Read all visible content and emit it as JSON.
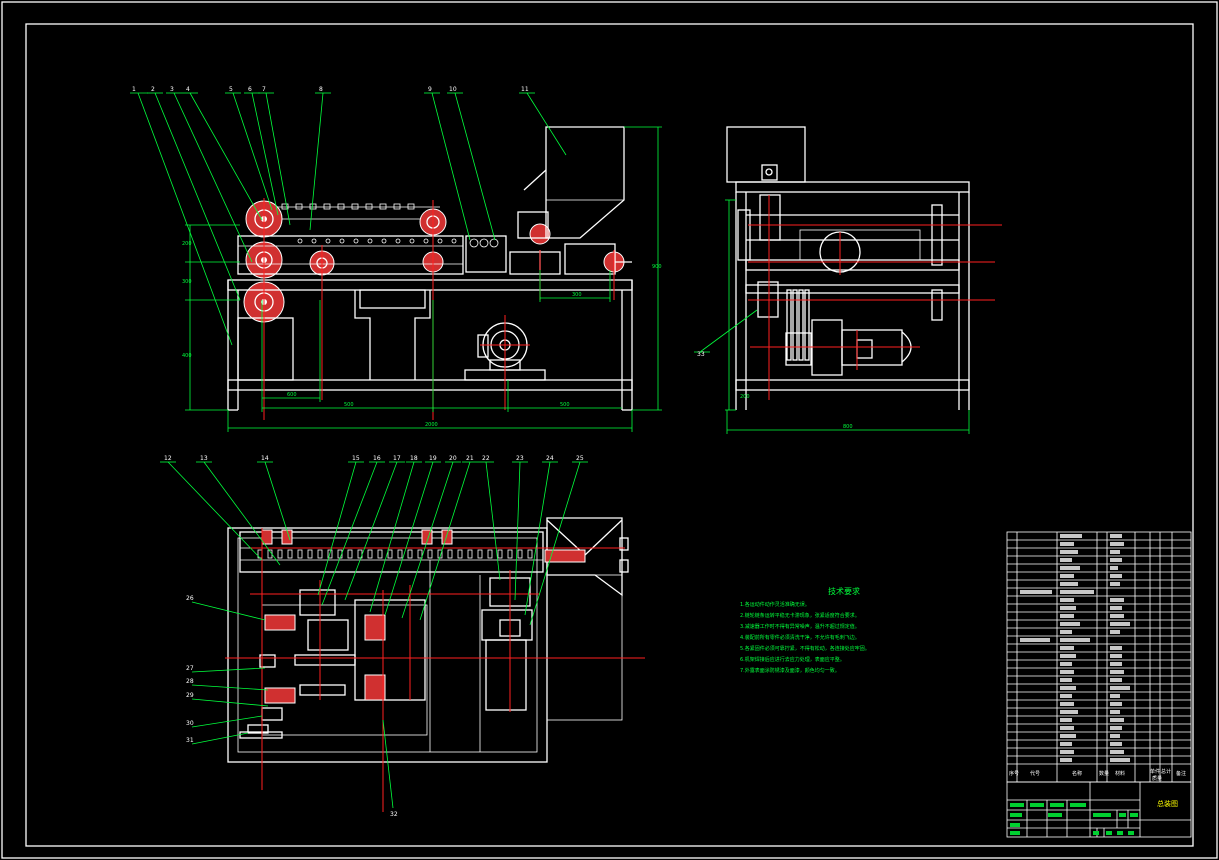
{
  "drawing": {
    "title_block": {
      "drawing_name": "总装图",
      "header_cols": [
        "序号",
        "代号",
        "名称",
        "数量",
        "材料",
        "单件",
        "总计",
        "备注"
      ],
      "mass_label": "质量"
    },
    "tech_requirements": {
      "title": "技术要求",
      "items": [
        "1.各运动件动作灵活准确无误。",
        "2.链轮链条运转平稳无卡滞现象，张紧适度符合要求。",
        "3.减速器工作时不得有异常噪声，温升不超过规定值。",
        "4.装配前所有零件必须清洗干净，不允许有毛刺飞边。",
        "5.各紧固件必须可靠拧紧，不得有松动，各连接处应牢固。",
        "6.机架焊接后应进行去应力处理，表面应平整。",
        "7.外露表面涂防锈漆及面漆，颜色均匀一致。"
      ]
    },
    "front_view_labels": [
      "1",
      "2",
      "3",
      "4",
      "5",
      "6",
      "7",
      "8",
      "9",
      "10",
      "11"
    ],
    "plan_view_labels": [
      "12",
      "13",
      "14",
      "15",
      "16",
      "17",
      "18",
      "19",
      "20",
      "21",
      "22",
      "23",
      "24",
      "25",
      "26",
      "27",
      "28",
      "29",
      "30",
      "31",
      "32"
    ],
    "side_view_labels": [
      "33"
    ],
    "dimensions": {
      "overall_length": "2000",
      "overall_height": "900",
      "side_width": "800",
      "span_a": "500",
      "span_b": "600",
      "span_c": "500",
      "feed_gap": "300",
      "left_h1": "200",
      "left_h2": "300",
      "left_h3": "400",
      "side_h": "200"
    }
  }
}
